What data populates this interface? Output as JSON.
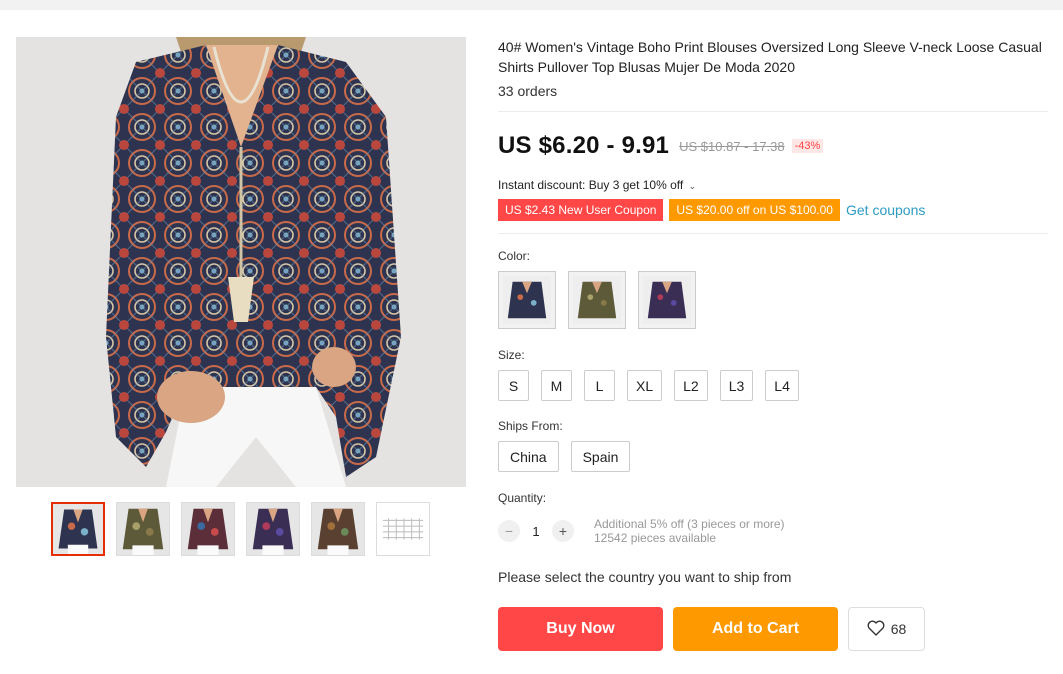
{
  "product": {
    "title": "40# Women's Vintage Boho Print Blouses Oversized Long Sleeve V-neck Loose Casual Shirts Pullover Top Blusas Mujer De Moda 2020",
    "orders": "33 orders",
    "price": "US $6.20 - 9.91",
    "old_price": "US $10.87 - 17.38",
    "discount": "-43%",
    "instant_discount": "Instant discount: Buy 3 get 10% off",
    "coupons": [
      {
        "label": "US $2.43 New User Coupon",
        "color": "#ff4747"
      },
      {
        "label": "US $20.00 off on US $100.00",
        "color": "#ff9900"
      }
    ],
    "get_coupons": "Get coupons"
  },
  "gallery": {
    "thumbnails": [
      {
        "palette": "navy",
        "selected": true
      },
      {
        "palette": "olive",
        "selected": false
      },
      {
        "palette": "red-blue",
        "selected": false
      },
      {
        "palette": "purple",
        "selected": false
      },
      {
        "palette": "brown",
        "selected": false
      },
      {
        "palette": "size-chart",
        "selected": false
      }
    ]
  },
  "options": {
    "color_label": "Color:",
    "colors": [
      "navy",
      "olive",
      "purple"
    ],
    "size_label": "Size:",
    "sizes": [
      "S",
      "M",
      "L",
      "XL",
      "L2",
      "L3",
      "L4"
    ],
    "ships_label": "Ships From:",
    "ships_from": [
      "China",
      "Spain"
    ],
    "quantity_label": "Quantity:",
    "quantity": "1",
    "quantity_minus": "−",
    "quantity_plus": "+",
    "quantity_note": "Additional 5% off (3 pieces or more)",
    "available": "12542 pieces available"
  },
  "shipping_note": "Please select the country you want to ship from",
  "actions": {
    "buy_now": "Buy Now",
    "add_to_cart": "Add to Cart",
    "wishlist_count": "68"
  },
  "colors": {
    "accent_red": "#ff4747",
    "accent_orange": "#ff9900",
    "link_blue": "#2e9cc3"
  }
}
